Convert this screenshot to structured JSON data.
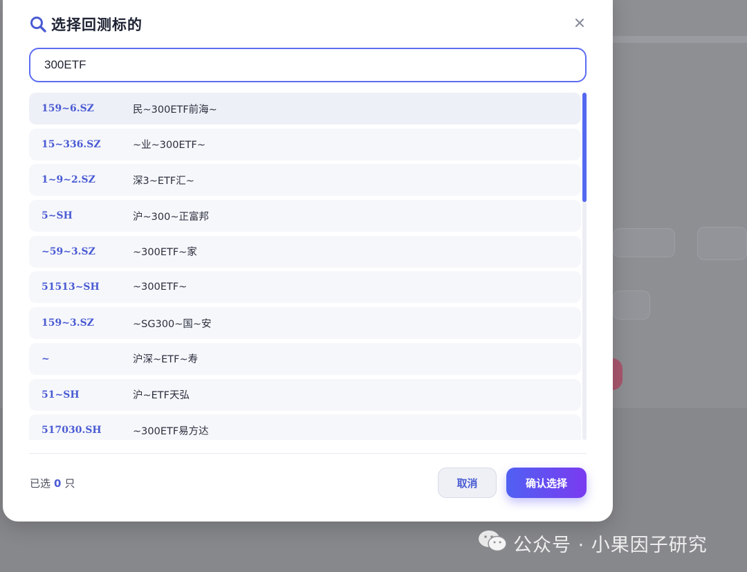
{
  "dialog": {
    "title": "选择回测标的",
    "search_value": "300ETF",
    "list": [
      {
        "code": "159~6.SZ",
        "name": "民~300ETF前海~"
      },
      {
        "code": "15~336.SZ",
        "name": "~业~300ETF~"
      },
      {
        "code": "1~9~2.SZ",
        "name": "深3~ETF汇~"
      },
      {
        "code": "5~SH",
        "name": "沪~300~正富邦"
      },
      {
        "code": "~59~3.SZ",
        "name": "~300ETF~家"
      },
      {
        "code": "51513~SH",
        "name": "~300ETF~"
      },
      {
        "code": "159~3.SZ",
        "name": "~SG300~国~安"
      },
      {
        "code": "~",
        "name": "沪深~ETF~寿"
      },
      {
        "code": "51~SH",
        "name": "沪~ETF天弘"
      },
      {
        "code": "517030.SH",
        "name": "~300ETF易方达"
      }
    ],
    "footer": {
      "selected_prefix": "已选",
      "selected_count": "0",
      "selected_suffix": "只",
      "cancel_label": "取消",
      "confirm_label": "确认选择"
    }
  },
  "watermark": {
    "text": "公众号 · 小果因子研究"
  },
  "colors": {
    "accent": "#5468f0",
    "confirm_gradient_start": "#5060f2",
    "confirm_gradient_end": "#7a3bf0",
    "backdrop": "#8e8f93"
  },
  "icons": {
    "search": "search-icon",
    "close": "close-icon",
    "watermark": "wechat-icon"
  }
}
